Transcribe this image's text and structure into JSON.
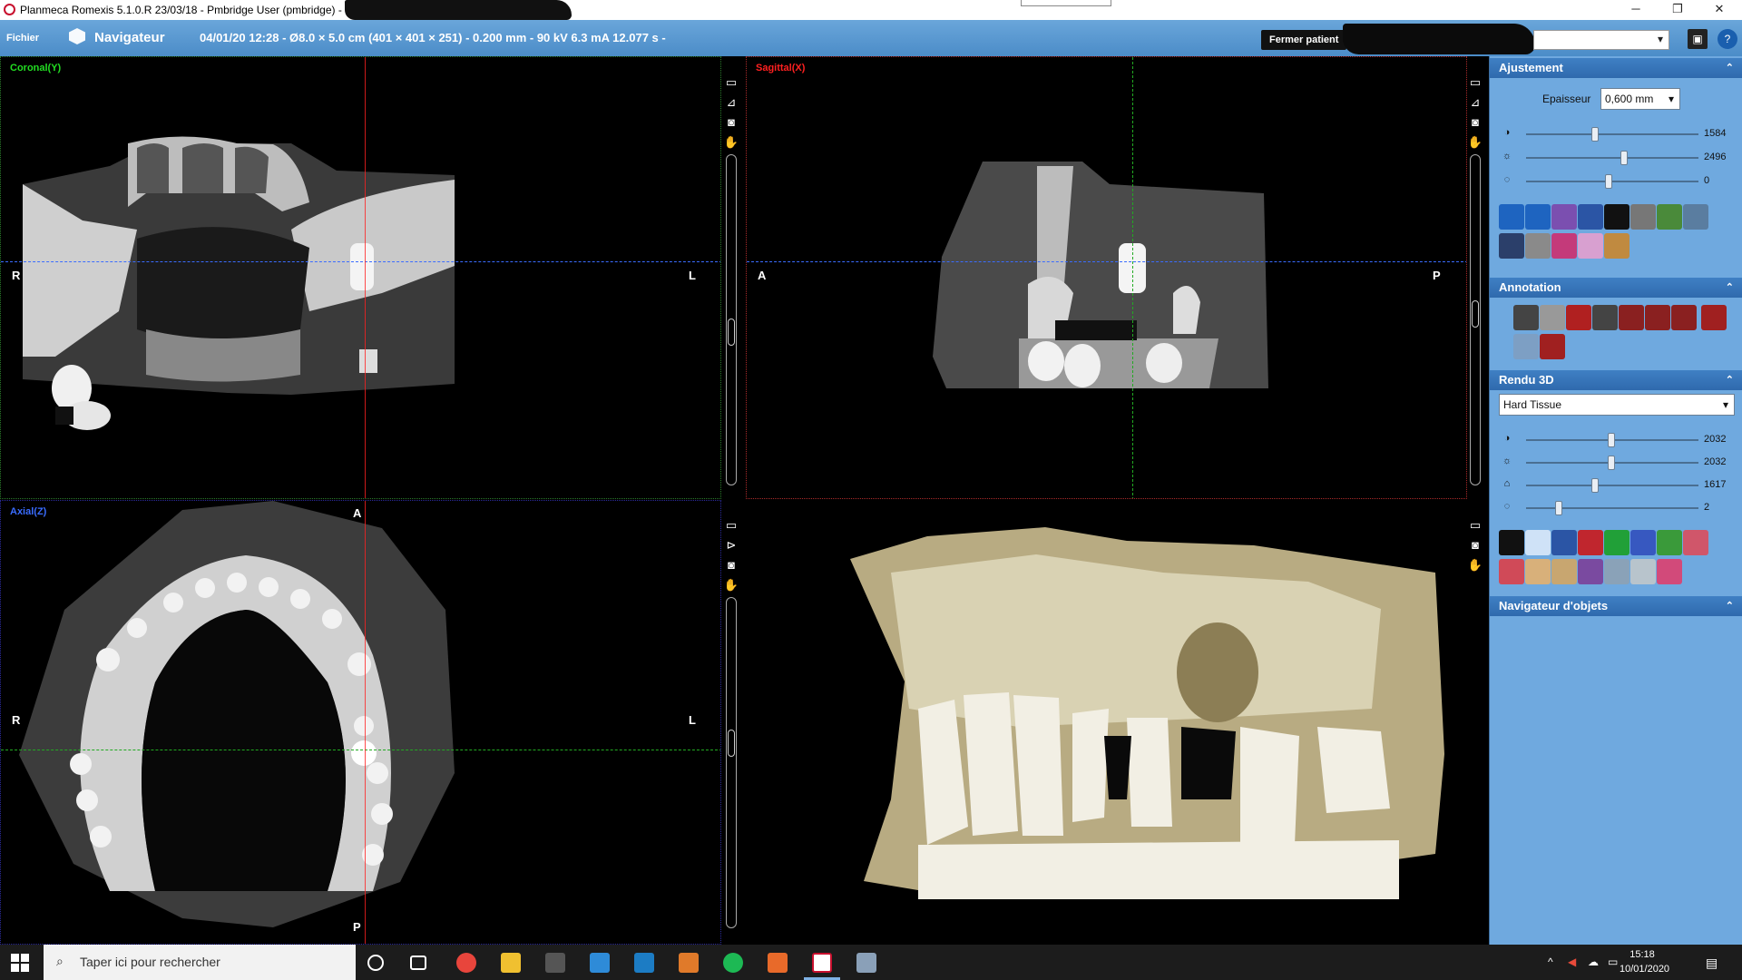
{
  "window": {
    "title": "Planmeca Romexis 5.1.0.R  23/03/18 - Pmbridge User (pmbridge) - L",
    "controls": {
      "minimize": "─",
      "maximize": "❐",
      "close": "✕"
    }
  },
  "toolbar": {
    "menu_file": "Fichier",
    "nav_label": "Navigateur",
    "scan_info": "04/01/20 12:28 - Ø8.0 × 5.0 cm (401 × 401 × 251) - 0.200 mm - 90 kV 6.3 mA 12.077 s -",
    "close_patient": "Fermer patient",
    "help_symbol": "?",
    "fullscreen_symbol": "▣"
  },
  "viewports": {
    "coronal": {
      "label": "Coronal(Y)",
      "left": "R",
      "right": "L"
    },
    "sagittal": {
      "label": "Sagittal(X)",
      "left": "A",
      "right": "P"
    },
    "axial": {
      "label": "Axial(Z)",
      "top": "A",
      "left": "R",
      "right": "L",
      "bottom": "P"
    }
  },
  "panel": {
    "adjust": {
      "title": "Ajustement",
      "thickness_label": "Epaisseur",
      "thickness_value": "0,600 mm",
      "sliders": [
        {
          "icon": "contrast-icon",
          "value": "1584",
          "level": 0.38
        },
        {
          "icon": "brightness-icon",
          "value": "2496",
          "level": 0.55
        },
        {
          "icon": "gamma-icon",
          "value": "0",
          "level": 0.45
        }
      ]
    },
    "annotation": {
      "title": "Annotation"
    },
    "render3d": {
      "title": "Rendu 3D",
      "preset": "Hard Tissue",
      "sliders": [
        {
          "icon": "contrast-icon",
          "value": "2032",
          "level": 0.45
        },
        {
          "icon": "brightness-icon",
          "value": "2032",
          "level": 0.45
        },
        {
          "icon": "opacity-icon",
          "value": "1617",
          "level": 0.35
        },
        {
          "icon": "gamma-icon",
          "value": "2",
          "level": 0.17
        }
      ]
    },
    "object_navigator": {
      "title": "Navigateur d'objets"
    }
  },
  "taskbar": {
    "search_placeholder": "Taper ici pour rechercher",
    "time": "15:18",
    "date": "10/01/2020"
  },
  "colors": {
    "coronal": "#22dd22",
    "sagittal": "#ff2020",
    "axial": "#3a6cff",
    "panel_bg": "#6fa9df",
    "toolbar": "#5597d3"
  }
}
